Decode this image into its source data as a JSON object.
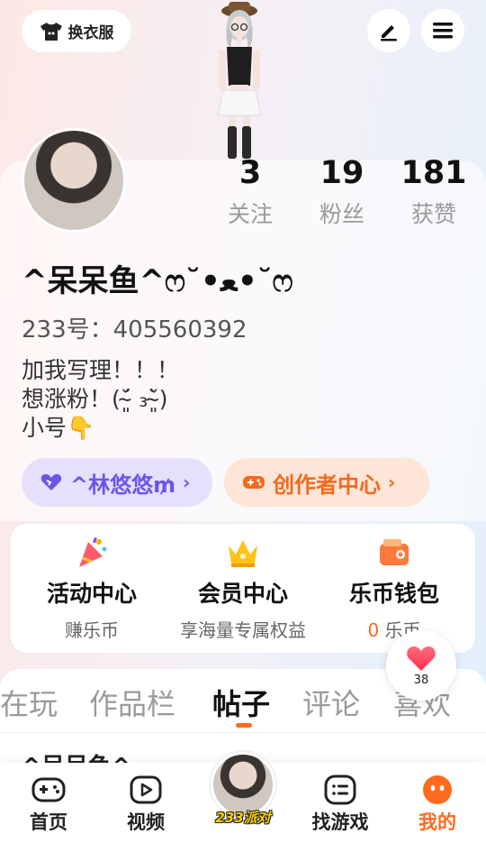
{
  "header": {
    "outfit_label": "换衣服",
    "edit_icon": "pen-icon",
    "menu_icon": "hamburger-icon"
  },
  "profile": {
    "stats": [
      {
        "value": "3",
        "label": "关注"
      },
      {
        "value": "19",
        "label": "粉丝"
      },
      {
        "value": "181",
        "label": "获赞"
      }
    ],
    "nickname": "^呆呆鱼^ෆ˘•ﻌ•˘ෆ",
    "user_id": "233号：405560392",
    "bio": "加我写理！！！\n想涨粉！(˘̴͈́ ₃˘̴͈̀)\n小号👇",
    "linked_account": "^林悠悠₥",
    "creator_center": "创作者中心"
  },
  "services": [
    {
      "title": "活动中心",
      "subtitle": "赚乐币",
      "icon": "party-popper-icon"
    },
    {
      "title": "会员中心",
      "subtitle": "享海量专属权益",
      "icon": "crown-icon"
    },
    {
      "title": "乐币钱包",
      "subtitle_num": "0",
      "subtitle_text": " 乐币",
      "icon": "wallet-icon"
    }
  ],
  "favorites": {
    "count": "38"
  },
  "tabs": [
    {
      "label": "在玩"
    },
    {
      "label": "作品栏"
    },
    {
      "label": "帖子"
    },
    {
      "label": "评论"
    },
    {
      "label": "喜欢"
    }
  ],
  "feed_peek": "^呆呆鱼^",
  "bottom_nav": [
    {
      "label": "首页"
    },
    {
      "label": "视频"
    },
    {
      "label": "233派对"
    },
    {
      "label": "找游戏"
    },
    {
      "label": "我的"
    }
  ],
  "colors": {
    "accent": "#ff6a1f",
    "purple": "#6c55e6"
  }
}
